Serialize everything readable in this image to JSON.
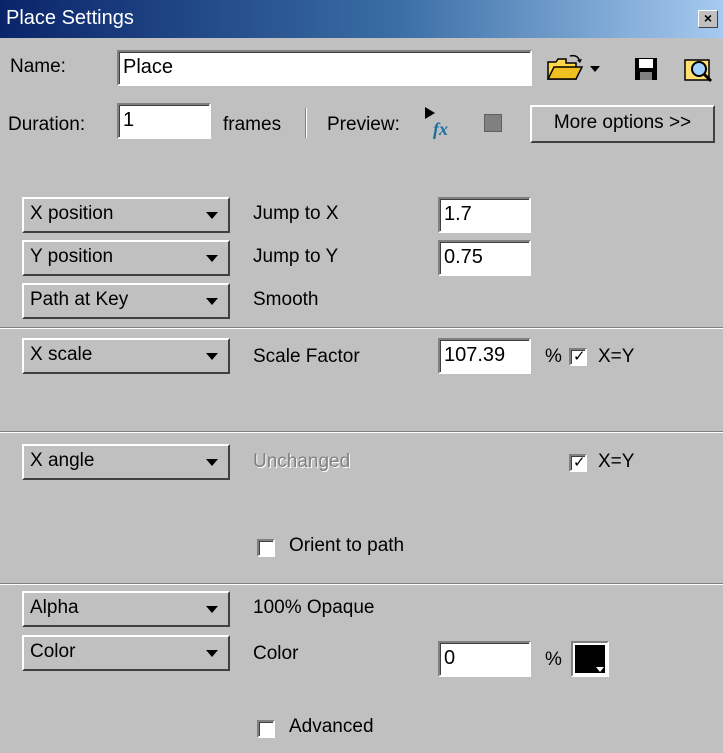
{
  "window": {
    "title": "Place Settings",
    "close_glyph": "×"
  },
  "name_row": {
    "label": "Name:",
    "value": "Place",
    "icons": [
      "open-folder-icon",
      "dropdown-arrow-icon",
      "save-icon",
      "browse-icon"
    ]
  },
  "duration_row": {
    "label": "Duration:",
    "value": "1",
    "unit": "frames",
    "preview_label": "Preview:",
    "more_options_label": "More options >>",
    "fx_text": "fx",
    "icons": [
      "preview-fx-icon",
      "stop-icon"
    ]
  },
  "position": {
    "x": {
      "dropdown": "X position",
      "label": "Jump to X",
      "value": "1.7"
    },
    "y": {
      "dropdown": "Y position",
      "label": "Jump to Y",
      "value": "0.75"
    },
    "path": {
      "dropdown": "Path at Key",
      "label": "Smooth"
    }
  },
  "scale": {
    "dropdown": "X scale",
    "label": "Scale Factor",
    "value": "107.39",
    "unit": "%",
    "xy_label": "X=Y",
    "xy_checked": true
  },
  "angle": {
    "dropdown": "X angle",
    "label": "Unchanged",
    "xy_label": "X=Y",
    "xy_checked": true,
    "orient_label": "Orient to path",
    "orient_checked": false
  },
  "alpha": {
    "dropdown": "Alpha",
    "label": "100% Opaque"
  },
  "color": {
    "dropdown": "Color",
    "label": "Color",
    "value": "0",
    "unit": "%",
    "swatch": "#000000",
    "advanced_label": "Advanced",
    "advanced_checked": false
  },
  "colors": {
    "titlebar_start": "#0a246a",
    "titlebar_end": "#a6caf0",
    "face": "#c0c0c0"
  }
}
